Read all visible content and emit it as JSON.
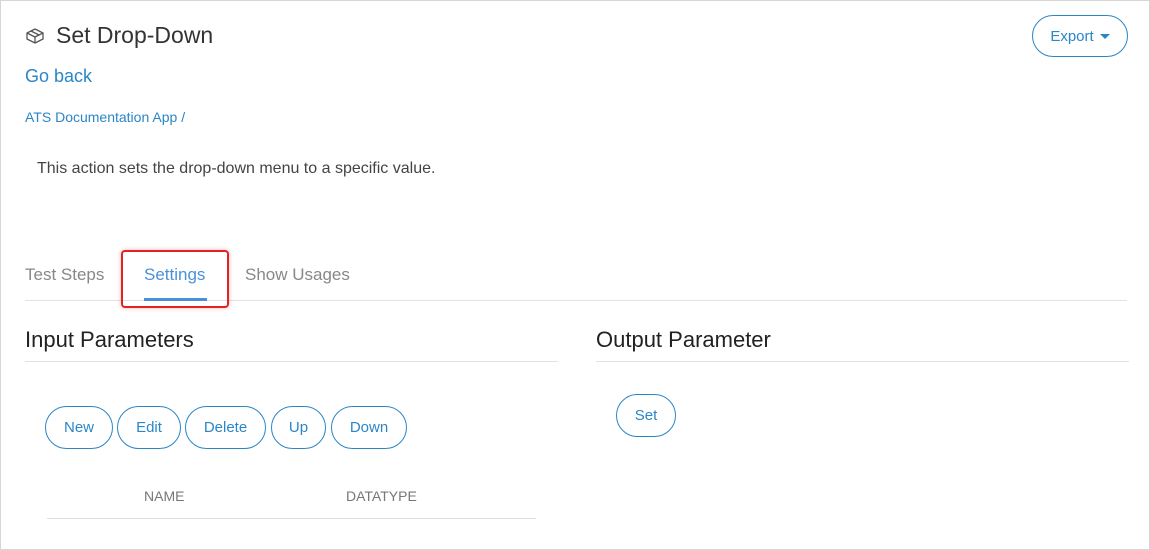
{
  "header": {
    "title": "Set Drop-Down",
    "icon": "cube-icon",
    "go_back": "Go back",
    "breadcrumb": {
      "app": "ATS Documentation App",
      "separator": "/"
    },
    "description": "This action sets the drop-down menu to a specific value.",
    "export_label": "Export"
  },
  "tabs": [
    {
      "label": "Test Steps",
      "active": false
    },
    {
      "label": "Settings",
      "active": true
    },
    {
      "label": "Show Usages",
      "active": false
    }
  ],
  "input_parameters": {
    "title": "Input Parameters",
    "buttons": [
      "New",
      "Edit",
      "Delete",
      "Up",
      "Down"
    ],
    "columns": [
      "NAME",
      "DATATYPE"
    ]
  },
  "output_parameter": {
    "title": "Output Parameter",
    "set_label": "Set"
  },
  "colors": {
    "accent": "#2a86c7",
    "active_tab": "#4a90d9",
    "highlight": "#e02424"
  }
}
